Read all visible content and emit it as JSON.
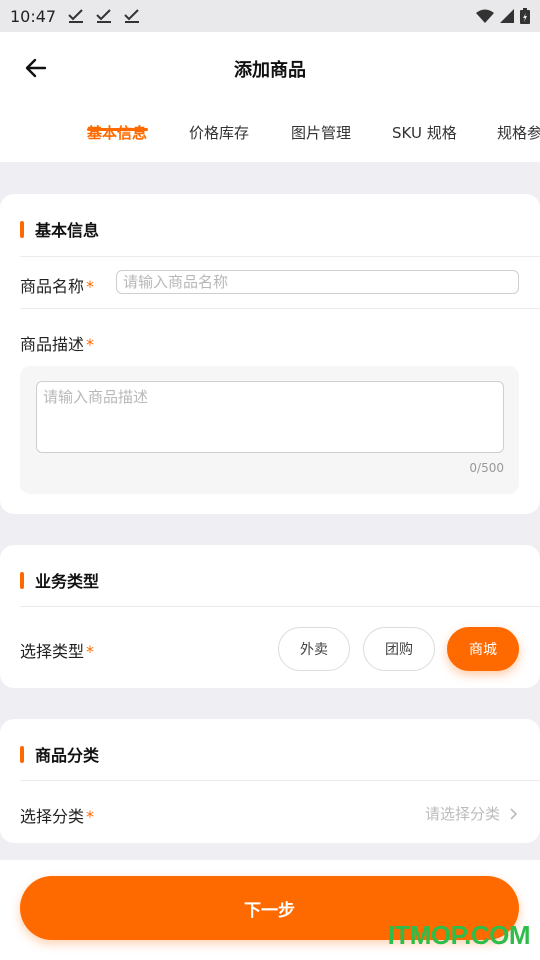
{
  "status_bar": {
    "time": "10:47"
  },
  "header": {
    "title": "添加商品"
  },
  "tabs": [
    {
      "label": "基本信息",
      "active": true
    },
    {
      "label": "价格库存",
      "active": false
    },
    {
      "label": "图片管理",
      "active": false
    },
    {
      "label": "SKU 规格",
      "active": false
    },
    {
      "label": "规格参",
      "active": false
    }
  ],
  "basic_info": {
    "title": "基本信息",
    "name_label": "商品名称",
    "name_placeholder": "请输入商品名称",
    "name_value": "",
    "desc_label": "商品描述",
    "desc_placeholder": "请输入商品描述",
    "desc_value": "",
    "desc_counter": "0/500",
    "required_mark": "*"
  },
  "business_type": {
    "title": "业务类型",
    "label": "选择类型",
    "required_mark": "*",
    "options": [
      "外卖",
      "团购",
      "商城"
    ],
    "selected": "商城"
  },
  "category": {
    "title": "商品分类",
    "label": "选择分类",
    "required_mark": "*",
    "placeholder": "请选择分类"
  },
  "footer": {
    "next_label": "下一步"
  },
  "watermark": "ITMOP.COM",
  "colors": {
    "accent": "#ff6a00",
    "background": "#efeff3",
    "watermark": "#2ebd4a"
  }
}
